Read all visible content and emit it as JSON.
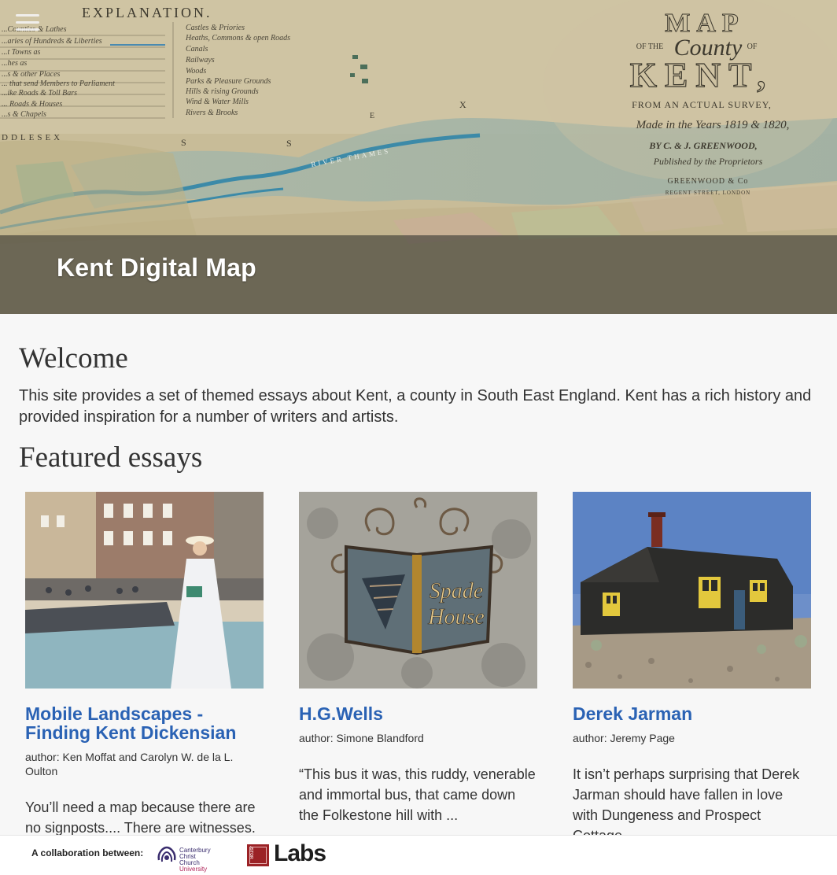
{
  "header": {
    "site_title": "Kent Digital Map",
    "menu_icon": "hamburger-icon"
  },
  "map_art": {
    "explanation_heading": "EXPLANATION.",
    "legend_right": [
      "Castles & Priories",
      "Heaths, Commons & open Roads",
      "Canals",
      "Railways",
      "Woods",
      "Parks & Pleasure Grounds",
      "Hills & rising Grounds",
      "Wind & Water Mills",
      "Rivers & Brooks"
    ],
    "legend_left": [
      "...Counties & Lathes",
      "...aries of Hundreds & Liberties",
      "...t Towns as",
      "...hes as",
      "...s & other Places",
      "... that send Members to Parliament",
      "...ike Roads & Toll Bars",
      "... Roads & Houses",
      "...s & Chapels"
    ],
    "cartouche": {
      "line1": "MAP",
      "line2": "OF THE",
      "line3": "County",
      "line4": "OF",
      "line5": "KENT,",
      "line6": "FROM AN ACTUAL SURVEY,",
      "line7": "Made in the Years 1819 & 1820,",
      "line8": "BY C. & J. GREENWOOD,",
      "line9": "Published by the Proprietors",
      "line10": "GREENWOOD & Co",
      "line11": "REGENT STREET, LONDON"
    },
    "river_label": "RIVER THAMES",
    "place_fragment": "DDLESEX",
    "letters": [
      "S",
      "S",
      "X",
      "E"
    ]
  },
  "main": {
    "welcome_heading": "Welcome",
    "intro": "This site provides a set of themed essays about Kent, a county in South East England. Kent has a rich history and provided inspiration for a number of writers and artists.",
    "featured_heading": "Featured essays"
  },
  "essays": [
    {
      "title": "Mobile Landscapes - Finding Kent Dickensian",
      "author": "author: Ken Moffat and Carolyn W. de la L. Oulton",
      "excerpt": "You’ll need a map because there are no signposts.... There are witnesses."
    },
    {
      "title": "H.G.Wells",
      "author": "author: Simone Blandford",
      "excerpt": "“This bus it was, this ruddy, venerable and immortal bus, that came down the Folkestone hill with ..."
    },
    {
      "title": "Derek Jarman",
      "author": "author: Jeremy Page",
      "excerpt": "It isn’t perhaps surprising that Derek Jarman should have fallen in love with Dungeness and Prospect Cottage..."
    }
  ],
  "thumb_sign": {
    "line1": "Spade",
    "line2": "House"
  },
  "footer": {
    "collab_label": "A collaboration between:",
    "partner1_line1": "Canterbury",
    "partner1_line2": "Christ Church",
    "partner1_line3": "University",
    "partner2_small": "JSTOR",
    "partner2_big": "Labs"
  },
  "colors": {
    "link": "#2a62b4",
    "title_band": "#37372f",
    "page_bg": "#f7f7f7"
  }
}
